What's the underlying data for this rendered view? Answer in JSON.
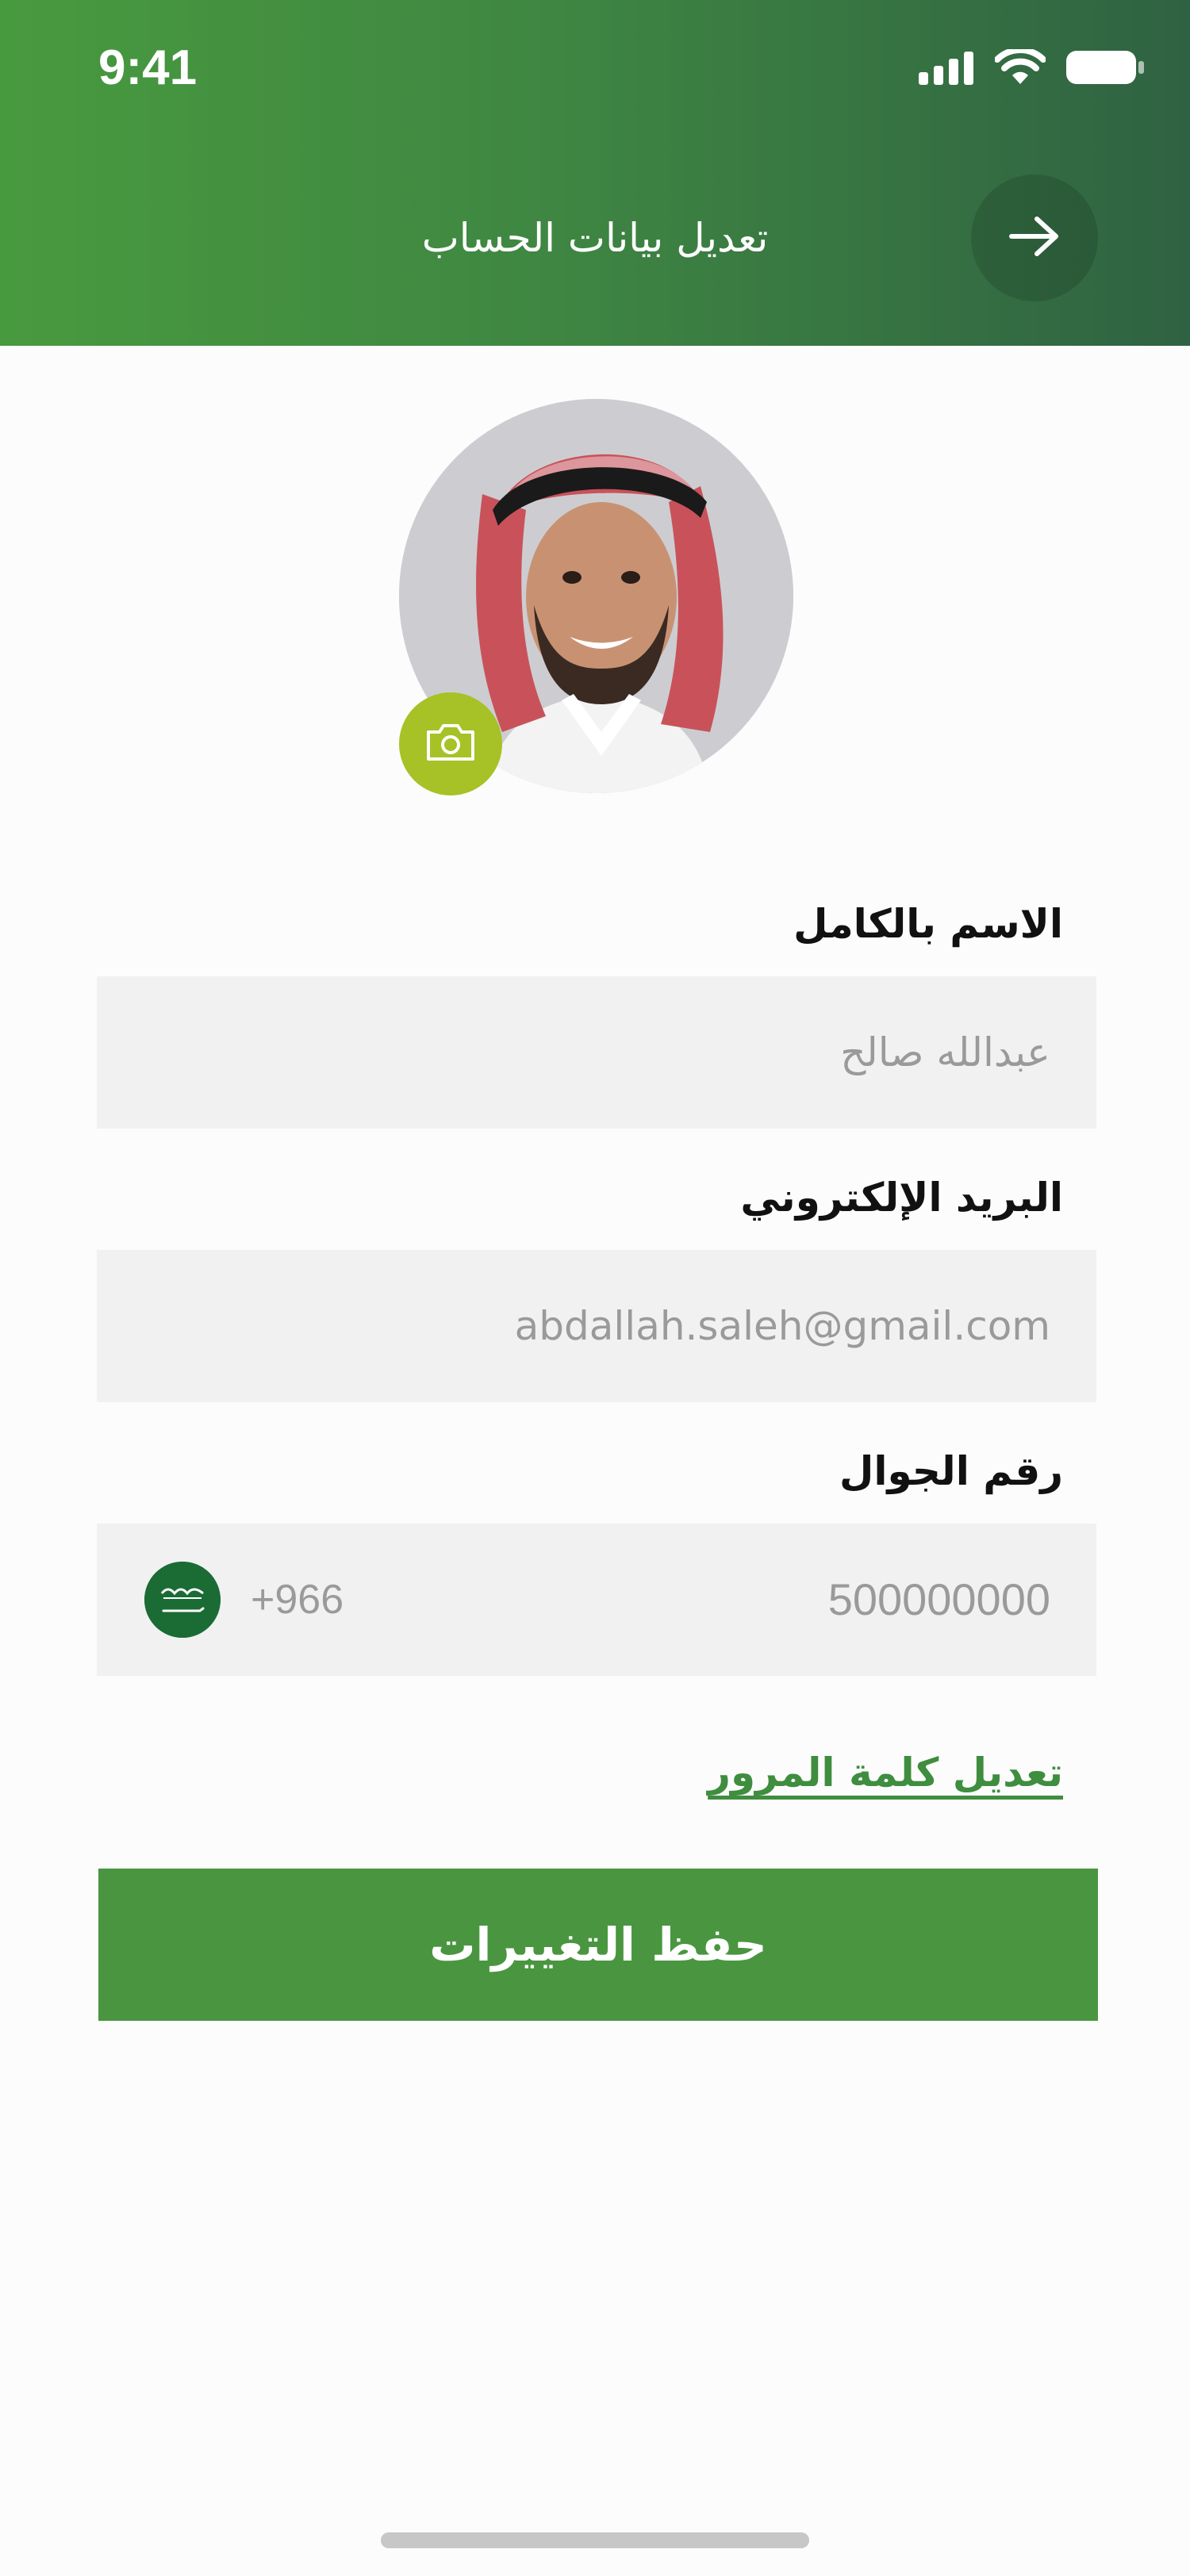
{
  "status_bar": {
    "time": "9:41",
    "icons": [
      "signal-icon",
      "wifi-icon",
      "battery-icon"
    ]
  },
  "header": {
    "title": "تعديل بيانات الحساب",
    "back_icon": "arrow-right-icon"
  },
  "profile": {
    "avatar": "user-avatar",
    "camera_icon": "camera-icon"
  },
  "form": {
    "full_name": {
      "label": "الاسم بالكامل",
      "value": "عبدالله صالح"
    },
    "email": {
      "label": "البريد الإلكتروني",
      "value": "abdallah.saleh@gmail.com"
    },
    "phone": {
      "label": "رقم الجوال",
      "value": "500000000",
      "country_code": "+966",
      "flag_icon": "saudi-flag-icon"
    }
  },
  "links": {
    "change_password": "تعديل كلمة المرور"
  },
  "actions": {
    "save_label": "حفظ التغييرات"
  },
  "colors": {
    "primary_green": "#4a9640",
    "header_dark_green": "#2f6242",
    "camera_lime": "#a6c226",
    "field_bg": "#f1f1f1",
    "link_green": "#3f8d3f"
  }
}
